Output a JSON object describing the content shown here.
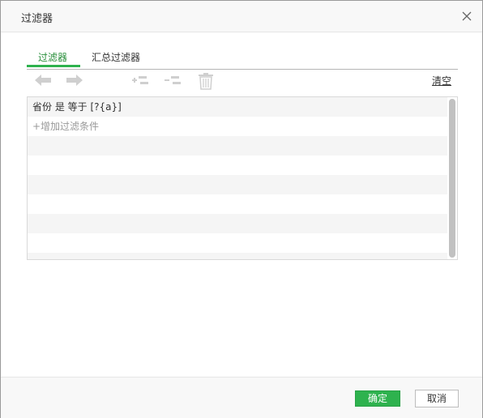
{
  "dialog": {
    "title": "过滤器"
  },
  "tabs": [
    {
      "label": "过滤器",
      "active": true
    },
    {
      "label": "汇总过滤器",
      "active": false
    }
  ],
  "toolbar": {
    "icons": [
      "arrow-left-icon",
      "arrow-right-icon",
      "add-condition-icon",
      "remove-condition-icon",
      "trash-icon"
    ],
    "clear_label": "清空"
  },
  "filters": {
    "conditions": [
      "省份 是 等于 [?{a}]"
    ],
    "add_label": "+增加过滤条件"
  },
  "footer": {
    "ok_label": "确定",
    "cancel_label": "取消"
  },
  "colors": {
    "accent": "#2eb24e",
    "row_alt": "#f5f5f5",
    "disabled_icon": "#cfcfcf",
    "scrollbar": "#c1c1c1"
  }
}
